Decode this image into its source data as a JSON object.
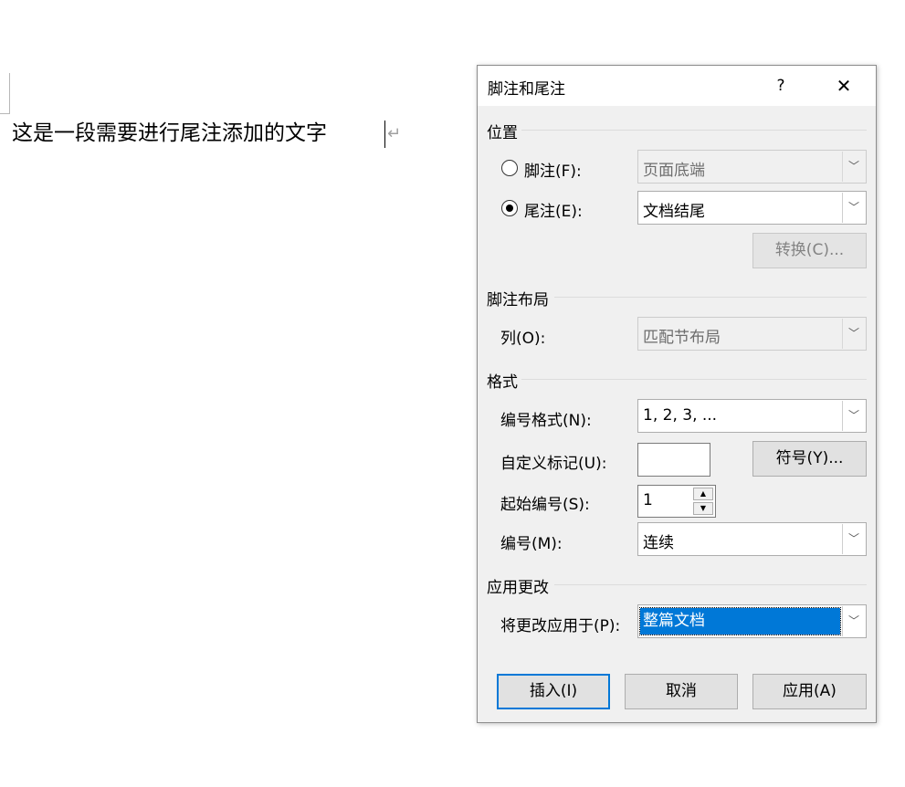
{
  "document": {
    "text": "这是一段需要进行尾注添加的文字",
    "paragraph_mark": "↵"
  },
  "dialog": {
    "title": "脚注和尾注",
    "help_label": "?",
    "close_label": "✕",
    "location": {
      "heading": "位置",
      "footnote": {
        "label": "脚注(F):",
        "value": "页面底端",
        "selected": false
      },
      "endnote": {
        "label": "尾注(E):",
        "value": "文档结尾",
        "selected": true
      },
      "convert_button": "转换(C)..."
    },
    "footnote_layout": {
      "heading": "脚注布局",
      "columns_label": "列(O):",
      "columns_value": "匹配节布局"
    },
    "format": {
      "heading": "格式",
      "number_format_label": "编号格式(N):",
      "number_format_value": "1, 2, 3, ...",
      "custom_mark_label": "自定义标记(U):",
      "custom_mark_value": "",
      "symbol_button": "符号(Y)...",
      "start_at_label": "起始编号(S):",
      "start_at_value": "1",
      "numbering_label": "编号(M):",
      "numbering_value": "连续"
    },
    "apply_changes": {
      "heading": "应用更改",
      "apply_to_label": "将更改应用于(P):",
      "apply_to_value": "整篇文档"
    },
    "buttons": {
      "insert": "插入(I)",
      "cancel": "取消",
      "apply": "应用(A)"
    }
  },
  "colors": {
    "dialog_bg": "#f0f0f0",
    "accent": "#0078d7",
    "border": "#adadad"
  }
}
